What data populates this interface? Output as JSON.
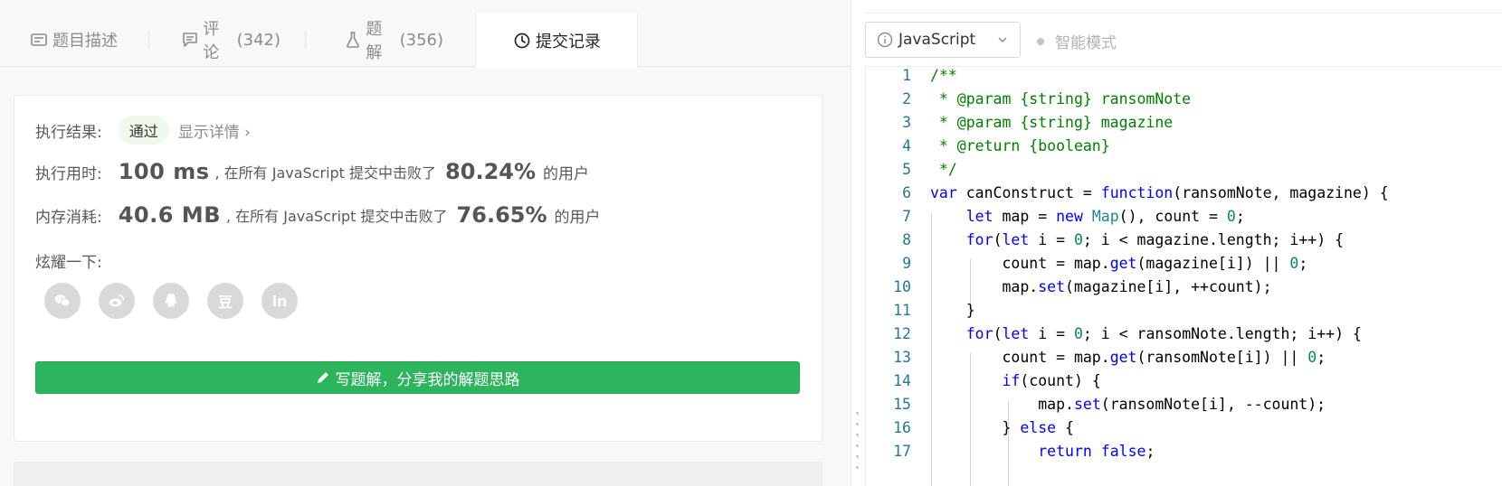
{
  "tabs": [
    {
      "label": "题目描述",
      "count": "",
      "icon": "description-icon"
    },
    {
      "label": "评论",
      "count": "(342)",
      "icon": "comment-icon"
    },
    {
      "label": "题解",
      "count": "(356)",
      "icon": "flask-icon"
    },
    {
      "label": "提交记录",
      "count": "",
      "icon": "clock-icon",
      "active": true
    }
  ],
  "result": {
    "label": "执行结果:",
    "status": "通过",
    "details": "显示详情 ›"
  },
  "runtime": {
    "label": "执行用时:",
    "value": "100 ms",
    "text": ", 在所有 JavaScript 提交中击败了",
    "percent": "80.24%",
    "suffix": "的用户"
  },
  "memory": {
    "label": "内存消耗:",
    "value": "40.6 MB",
    "text": ", 在所有 JavaScript 提交中击败了",
    "percent": "76.65%",
    "suffix": "的用户"
  },
  "share": {
    "label": "炫耀一下:",
    "icons": [
      "wechat-icon",
      "weibo-icon",
      "qq-icon",
      "douban-icon",
      "linkedin-icon"
    ],
    "douban_glyph": "豆",
    "linkedin_glyph": "in"
  },
  "write_solution_button": "写题解，分享我的解题思路",
  "editor": {
    "language": "JavaScript",
    "smart_mode": "智能模式",
    "lines": [
      "1",
      "2",
      "3",
      "4",
      "5",
      "6",
      "7",
      "8",
      "9",
      "10",
      "11",
      "12",
      "13",
      "14",
      "15",
      "16",
      "17"
    ]
  },
  "colors": {
    "accent_green": "#2db55d",
    "comment": "#008000",
    "keyword": "#0000ff",
    "number": "#09885a",
    "line_number": "#237893"
  }
}
